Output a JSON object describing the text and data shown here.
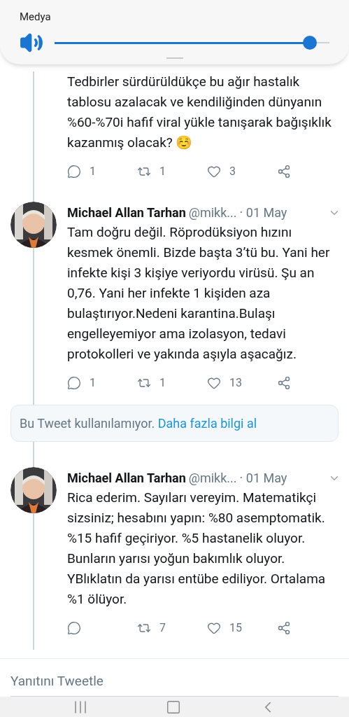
{
  "volume_panel": {
    "label": "Medya",
    "level": 0.93
  },
  "thread": [
    {
      "kind": "partial",
      "text": "Tedbirler sürdürüldükçe bu ağır hastalık tablosu azalacak ve kendiliğinden dünyanın %60-%70i hafif viral yükle tanışarak bağışıklık kazanmış olacak? ☺️",
      "actions": {
        "replies": "1",
        "retweets": "1",
        "likes": "3"
      }
    },
    {
      "kind": "tweet",
      "name": "Michael Allan Tarhan",
      "handle": "@mikk...",
      "date": "· 01 May",
      "text": "Tam doğru değil. Röprodüksiyon hızını kesmek önemli. Bizde başta 3’tü bu. Yani her infekte kişi 3 kişiye veriyordu virüsü. Şu an 0,76. Yani her infekte 1 kişiden aza bulaştırıyor.Nedeni karantina.Bulaşı engelleyemiyor ama izolasyon, tedavi protokolleri ve yakında aşıyla aşacağız.",
      "actions": {
        "replies": "1",
        "retweets": "1",
        "likes": "13"
      }
    },
    {
      "kind": "unavailable",
      "text": "Bu Tweet kullanılamıyor.",
      "link": "Daha fazla bilgi al"
    },
    {
      "kind": "tweet",
      "name": "Michael Allan Tarhan",
      "handle": "@mikk...",
      "date": "· 01 May",
      "text": "Rica ederim. Sayıları vereyim. Matematikçi sizsiniz; hesabını yapın: %80 asemptomatik. %15 hafif geçiriyor. %5 hastanelik oluyor. Bunların yarısı yoğun bakımlık oluyor. YBlıklatın da yarısı entübe ediliyor. Ortalama %1 ölüyor.",
      "actions": {
        "retweets": "7",
        "likes": "15"
      }
    }
  ],
  "reply_field": {
    "placeholder": "Yanıtını Tweetle"
  }
}
